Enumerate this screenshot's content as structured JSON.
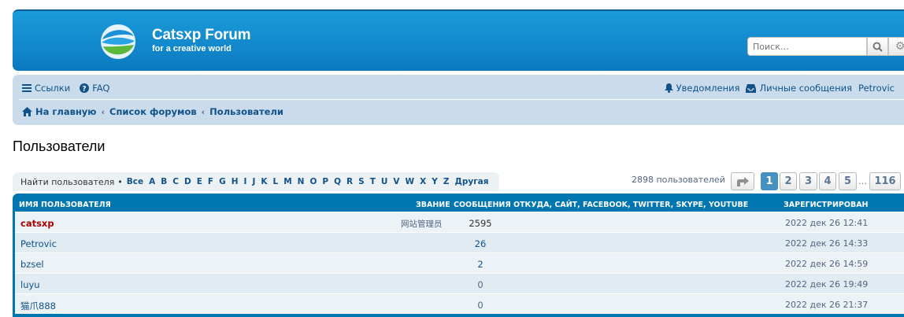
{
  "header": {
    "site_title": "Catsxp Forum",
    "site_description": "for a creative world",
    "search_placeholder": "Поиск…",
    "search_icon": "search-icon",
    "advanced_search_icon": "gear-icon",
    "brand_color": "#1288cc"
  },
  "nav": {
    "links_label": "Ссылки",
    "faq_label": "FAQ",
    "notifications_label": "Уведомления",
    "messages_label": "Личные сообщения",
    "user_label": "Petrovic"
  },
  "breadcrumbs": [
    "На главную",
    "Список форумов",
    "Пользователи"
  ],
  "page_title": "Пользователи",
  "letters": {
    "label": "Найти пользователя",
    "bullet": "•",
    "items": [
      "Все",
      "A",
      "B",
      "C",
      "D",
      "E",
      "F",
      "G",
      "H",
      "I",
      "J",
      "K",
      "L",
      "M",
      "N",
      "O",
      "P",
      "Q",
      "R",
      "S",
      "T",
      "U",
      "V",
      "W",
      "X",
      "Y",
      "Z",
      "Другая"
    ]
  },
  "pagination": {
    "count_text": "2898 пользователей",
    "jump_icon": "arrow-jump-icon",
    "pages": [
      "1",
      "2",
      "3",
      "4",
      "5"
    ],
    "current": "1",
    "ellipsis": "…",
    "last": "116"
  },
  "table": {
    "columns": {
      "username": "Имя пользователя",
      "rank": "Звание",
      "posts": "Сообщения",
      "contacts": "Откуда, Сайт, Facebook, Twitter, Skype, YouTube",
      "joined": "Зарегистрирован"
    },
    "rows": [
      {
        "username": "catsxp",
        "rank": "网站管理员",
        "posts": "2595",
        "joined": "2022 дек 26 12:41"
      },
      {
        "username": "Petrovic",
        "rank": "",
        "posts": "26",
        "joined": "2022 дек 26 14:33"
      },
      {
        "username": "bzsel",
        "rank": "",
        "posts": "2",
        "joined": "2022 дек 26 14:59"
      },
      {
        "username": "luyu",
        "rank": "",
        "posts": "0",
        "joined": "2022 дек 26 19:49"
      },
      {
        "username": "猫爪888",
        "rank": "",
        "posts": "0",
        "joined": "2022 дек 26 21:37"
      }
    ]
  }
}
